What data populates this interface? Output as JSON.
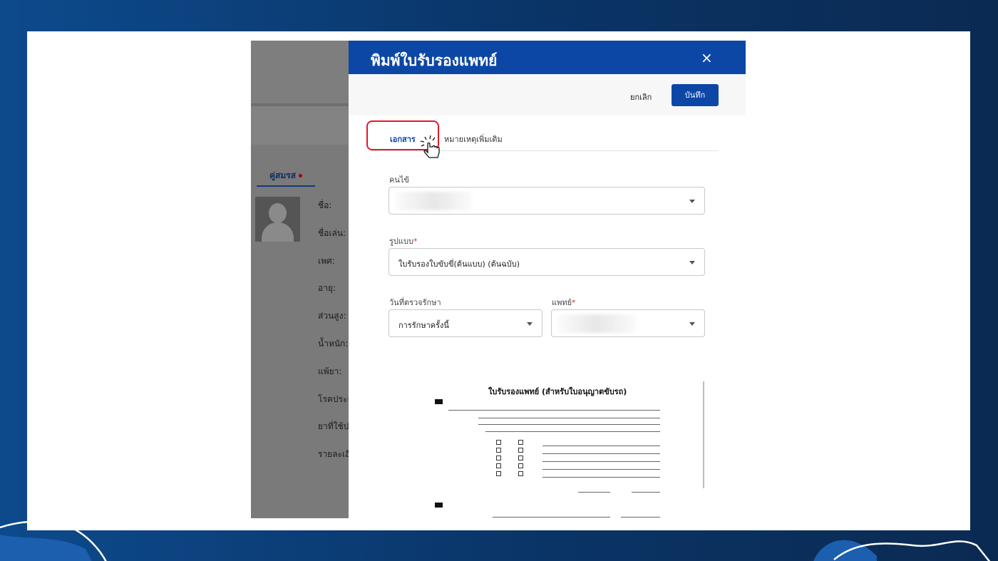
{
  "dialog": {
    "title": "พิมพ์ใบรับรองแพทย์",
    "close_label": "×",
    "cancel_label": "ยกเลิก",
    "save_label": "บันทึก",
    "tabs": [
      {
        "label": "เอกสาร",
        "active": true
      },
      {
        "label": "หมายเหตุเพิ่มเติม",
        "active": false
      }
    ],
    "fields": {
      "patient": {
        "label": "คนไข้",
        "value": ""
      },
      "format": {
        "label": "รูปแบบ",
        "required_mark": "*",
        "value": "ใบรับรองใบขับขี่(ต้นแบบ) (ต้นฉบับ)"
      },
      "treatment_date": {
        "label": "วันที่ตรวจรักษา",
        "value": "การรักษาครั้งนี้"
      },
      "doctor": {
        "label": "แพทย์",
        "required_mark": "*",
        "value": ""
      }
    },
    "preview": {
      "title": "ใบรับรองแพทย์ (สำหรับใบอนุญาตขับรถ)"
    }
  },
  "background_app": {
    "tab_label": "คู่สมรส",
    "fields": [
      "ชื่อ:",
      "ชื่อเล่น:",
      "เพศ:",
      "อายุ:",
      "ส่วนสูง:",
      "น้ำหนัก:",
      "แพ้ยา:",
      "โรคประจ",
      "ยาที่ใช้ป",
      "รายละเอี"
    ]
  },
  "colors": {
    "brand_blue": "#0c47a6",
    "highlight_red": "#e2182a",
    "page_bg": "#0a3a6e"
  }
}
